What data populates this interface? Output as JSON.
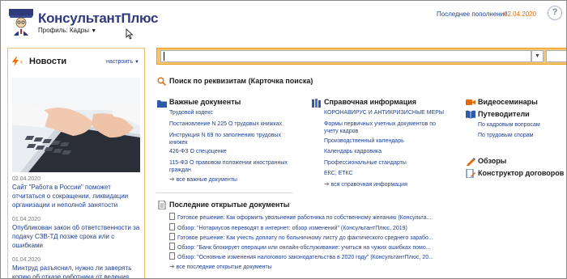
{
  "header": {
    "logo_title": "КонсультантПлюс",
    "profile_label": "Профиль: Кадры",
    "update_label": "Последнее пополнение",
    "update_date": "02.04.2020",
    "help_symbol": "?"
  },
  "news": {
    "title": "Новости",
    "configure_label": "настроить",
    "items": [
      {
        "date": "02.04.2020",
        "text": "Сайт \"Работа в России\" поможет отчитаться о сокращении, ликвидации организации и неполной занятости"
      },
      {
        "date": "01.04.2020",
        "text": "Опубликован закон об ответственности за подачу СЗВ-ТД позже срока или с ошибками"
      },
      {
        "date": "01.04.2020",
        "text": "Минтруд разъяснил, нужно ли заверять копию об отказе работника от ведения"
      }
    ]
  },
  "search": {
    "value": "",
    "dropdown_symbol": "▼"
  },
  "requisites_search_label": "Поиск по реквизитам (Карточка поиска)",
  "important_docs": {
    "title": "Важные документы",
    "links": [
      "Трудовой кодекс",
      "Постановление N 225 О трудовых книжках",
      "Инструкция N 69 по заполнению трудовых книжек",
      "426-ФЗ О спецоценке",
      "115-ФЗ О правовом положении иностранных граждан"
    ],
    "more_label": "все важные документы"
  },
  "reference_info": {
    "title": "Справочная информация",
    "links": [
      "КОРОНАВИРУС И АНТИКРИЗИСНЫЕ МЕРЫ",
      "Формы первичных учетных документов по учету кадров",
      "Производственный календарь",
      "Календарь кадровика",
      "Профессиональные стандарты",
      "ЕКС, ЕТКС"
    ],
    "more_label": "вся справочная информация"
  },
  "right_col": {
    "video_label": "Видеосеминары",
    "guides_label": "Путеводители",
    "guide_links": [
      "По кадровым вопросам",
      "По трудовым спорам"
    ],
    "reviews_label": "Обзоры",
    "constructor_label": "Конструктор договоров"
  },
  "recent": {
    "title": "Последние открытые документы",
    "items": [
      "Готовое решение: Как оформить увольнение работника по собственному желанию (Консульта...",
      "Обзор: \"Нотариусов переводят в интернет: обзор изменений\" (КонсультантПлюс, 2019)",
      "Готовое решение: Как учесть доплату по больничному листу до фактического среднего зарабо...",
      "Обзор: \"Банк блокирует операции или онлайн-обслуживание: учиться на чужих ошибках помо...",
      "Обзор: \"Основные изменения налогового законодательства в 2020 году\" (КонсультантПлюс, 20..."
    ],
    "more_label": "все последние открытые документы"
  },
  "colors": {
    "link": "#1f3f8f",
    "accent_orange": "#e36c09",
    "search_bar": "#f6c56a"
  }
}
